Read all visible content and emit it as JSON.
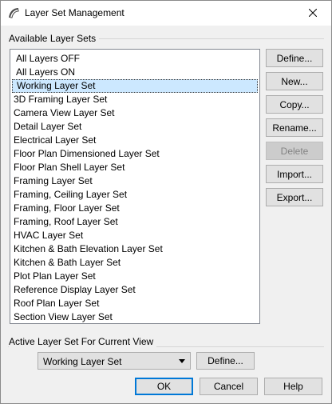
{
  "window": {
    "title": "Layer Set Management",
    "close_glyph": "✕"
  },
  "available": {
    "label": "Available Layer Sets",
    "items": [
      "All Layers OFF",
      "All Layers ON",
      "Working Layer Set",
      "3D Framing Layer Set",
      "Camera View Layer Set",
      "Detail Layer Set",
      "Electrical Layer Set",
      "Floor Plan Dimensioned Layer Set",
      "Floor Plan Shell Layer Set",
      "Framing Layer Set",
      "Framing, Ceiling Layer Set",
      "Framing, Floor Layer Set",
      "Framing, Roof Layer Set",
      "HVAC Layer Set",
      "Kitchen & Bath Elevation Layer Set",
      "Kitchen & Bath Layer Set",
      "Plot Plan Layer Set",
      "Reference Display Layer Set",
      "Roof Plan Layer Set",
      "Section View Layer Set"
    ],
    "selected_index": 2
  },
  "side_buttons": {
    "define": "Define...",
    "new": "New...",
    "copy": "Copy...",
    "rename": "Rename...",
    "delete": "Delete",
    "import": "Import...",
    "export": "Export..."
  },
  "active": {
    "label": "Active Layer Set For Current View",
    "value": "Working Layer Set",
    "define": "Define..."
  },
  "footer": {
    "ok": "OK",
    "cancel": "Cancel",
    "help": "Help"
  }
}
